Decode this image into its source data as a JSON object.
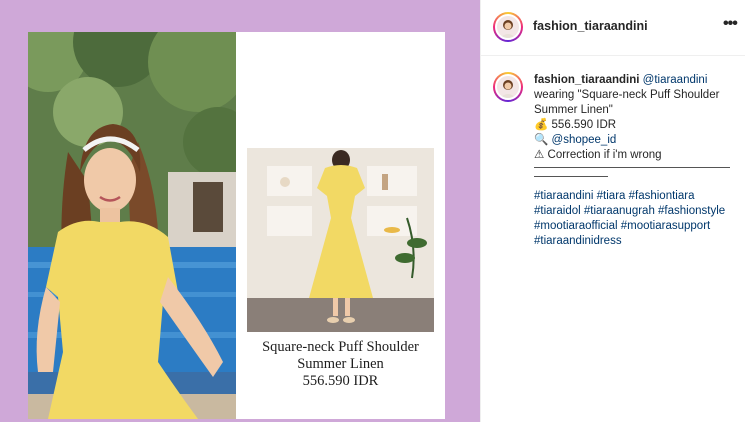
{
  "post": {
    "username": "fashion_tiaraandini",
    "more_icon": "more-options-icon"
  },
  "product_card": {
    "name_line1": "Square-neck Puff Shoulder",
    "name_line2": "Summer Linen",
    "price": "556.590 IDR"
  },
  "caption": {
    "username": "fashion_tiaraandini",
    "mention": "@tiaraandini",
    "wearing_text": "wearing \"Square-neck Puff Shoulder Summer Linen\"",
    "price_icon": "money-bag-icon",
    "price": "556.590 IDR",
    "shop_icon": "magnifier-icon",
    "shop_mention": "@shopee_id",
    "warning_icon": "warning-icon",
    "note": "Correction if i'm wrong",
    "hashtags": "#tiaraandini #tiara #fashiontiara #tiaraidol #tiaraanugrah #fashionstyle #mootiaraofficial #mootiarasupport #tiaraandinidress"
  },
  "colors": {
    "background_panel": "#cfa8d8",
    "link": "#00376b",
    "dress": "#f2d964"
  }
}
